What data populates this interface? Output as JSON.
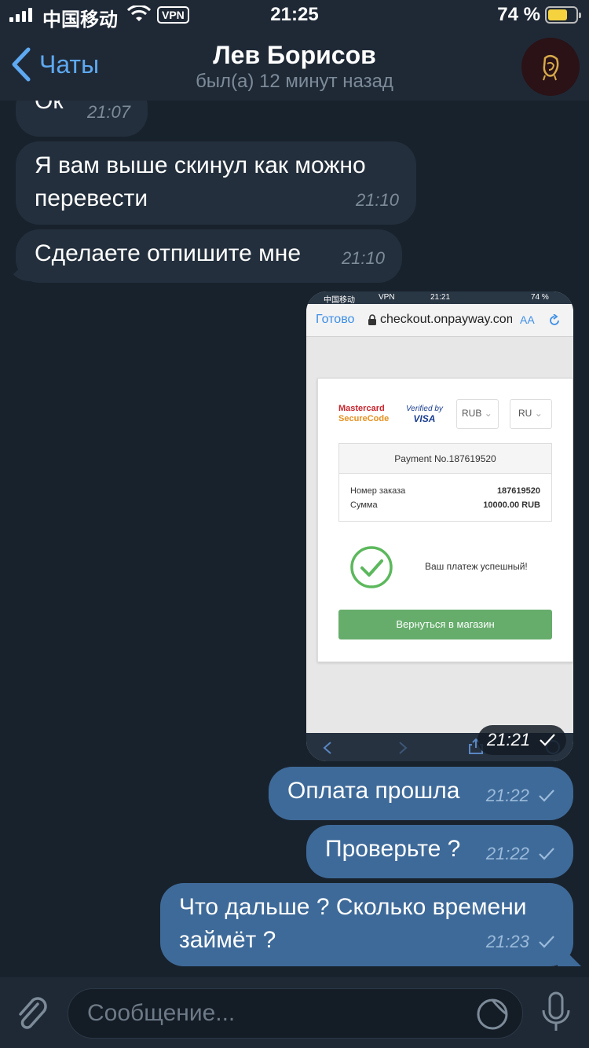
{
  "status_bar": {
    "carrier": "中国移动",
    "vpn": "VPN",
    "time": "21:25",
    "battery": "74 %"
  },
  "header": {
    "back_label": "Чаты",
    "title": "Лев Борисов",
    "subtitle": "был(а) 12 минут назад"
  },
  "messages": [
    {
      "text": "Ок",
      "time": "21:07",
      "direction": "in"
    },
    {
      "text": "Я вам выше скинул как можно перевести",
      "time": "21:10",
      "direction": "in"
    },
    {
      "text": "Сделаете отпишите мне",
      "time": "21:10",
      "direction": "in"
    },
    {
      "type": "image",
      "time": "21:21",
      "direction": "out"
    },
    {
      "text": "Оплата прошла",
      "time": "21:22",
      "direction": "out"
    },
    {
      "text": "Проверьте ?",
      "time": "21:22",
      "direction": "out"
    },
    {
      "text": "Что дальше ? Сколько времени займёт ?",
      "time": "21:23",
      "direction": "out"
    }
  ],
  "screenshot": {
    "status_carrier": "中国移动",
    "status_vpn": "VPN",
    "status_time": "21:21",
    "status_battery": "74 %",
    "done": "Готово",
    "url": "checkout.onpayway.com",
    "aa": "AA",
    "mastercard_1": "Mastercard",
    "mastercard_2": "SecureCode",
    "visa_1": "Verified by",
    "visa_2": "VISA",
    "currency": "RUB",
    "language": "RU",
    "payment_title": "Payment No.187619520",
    "order_label": "Номер заказа",
    "order_value": "187619520",
    "sum_label": "Сумма",
    "sum_value": "10000.00 RUB",
    "success_text": "Ваш платеж успешный!",
    "return_button": "Вернуться в магазин"
  },
  "input": {
    "placeholder": "Сообщение..."
  },
  "colors": {
    "background": "#18222d",
    "incoming_bubble": "#232f3c",
    "outgoing_bubble": "#3e6a99",
    "accent": "#5ea9f1"
  }
}
